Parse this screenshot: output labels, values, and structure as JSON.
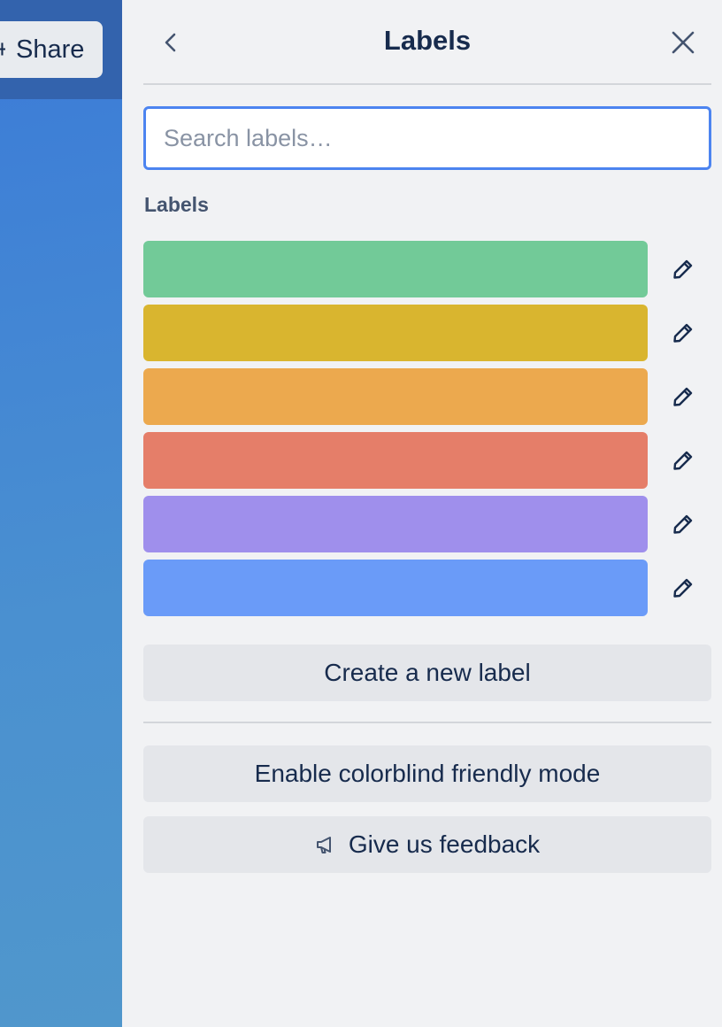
{
  "board": {
    "share_label": "Share",
    "share_prefix": "+"
  },
  "panel": {
    "title": "Labels",
    "search_placeholder": "Search labels…",
    "section_heading": "Labels",
    "labels": [
      {
        "color": "#72ca98",
        "name": ""
      },
      {
        "color": "#d9b52f",
        "name": ""
      },
      {
        "color": "#eca94e",
        "name": ""
      },
      {
        "color": "#e57e69",
        "name": ""
      },
      {
        "color": "#9f8fec",
        "name": ""
      },
      {
        "color": "#6a9bf8",
        "name": ""
      }
    ],
    "create_label": "Create a new label",
    "colorblind_label": "Enable colorblind friendly mode",
    "feedback_label": "Give us feedback"
  },
  "icons": {
    "back": "chevron-left-icon",
    "close": "close-icon",
    "edit": "pencil-icon",
    "feedback": "megaphone-icon"
  },
  "colors": {
    "text": "#172b4d",
    "panel_bg": "#f1f2f4",
    "focus_border": "#4c84f0",
    "board_bg": "#3b7bd8"
  }
}
